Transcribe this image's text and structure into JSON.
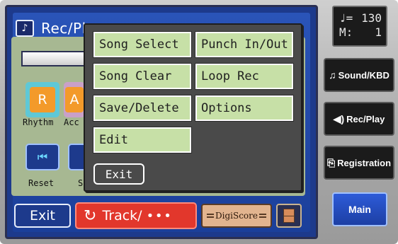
{
  "window": {
    "title": "Rec/Pl",
    "icon": "music-note-icon"
  },
  "background_screen": {
    "parts": [
      "R",
      "A"
    ],
    "part_labels": [
      "Rhythm",
      "Acc"
    ],
    "transport_labels": [
      "Reset",
      "S"
    ]
  },
  "menu": {
    "items": [
      {
        "label": "Song Select"
      },
      {
        "label": "Punch In/Out"
      },
      {
        "label": "Song Clear"
      },
      {
        "label": "Loop Rec"
      },
      {
        "label": "Save/Delete"
      },
      {
        "label": "Options"
      },
      {
        "label": "Edit"
      }
    ],
    "exit_label": "Exit"
  },
  "bottom_bar": {
    "exit_label": "Exit",
    "track_label": "Track/",
    "digiscore_label": "DigiScore",
    "track_color": "#e2372c"
  },
  "side_panel": {
    "tempo_symbol": "♩=",
    "tempo_value": "130",
    "measure_label": "M:",
    "measure_value": "1",
    "buttons": [
      {
        "label": "Sound/KBD",
        "icon": "music-notes-icon"
      },
      {
        "label": "Rec/Play",
        "icon": "speaker-icon"
      },
      {
        "label": "Registration",
        "icon": "book-icon"
      }
    ],
    "main_label": "Main"
  },
  "colors": {
    "screen_blue": "#1d3a8c",
    "menu_item_green": "#c7e0a7",
    "accent_orange": "#f39a2a"
  }
}
